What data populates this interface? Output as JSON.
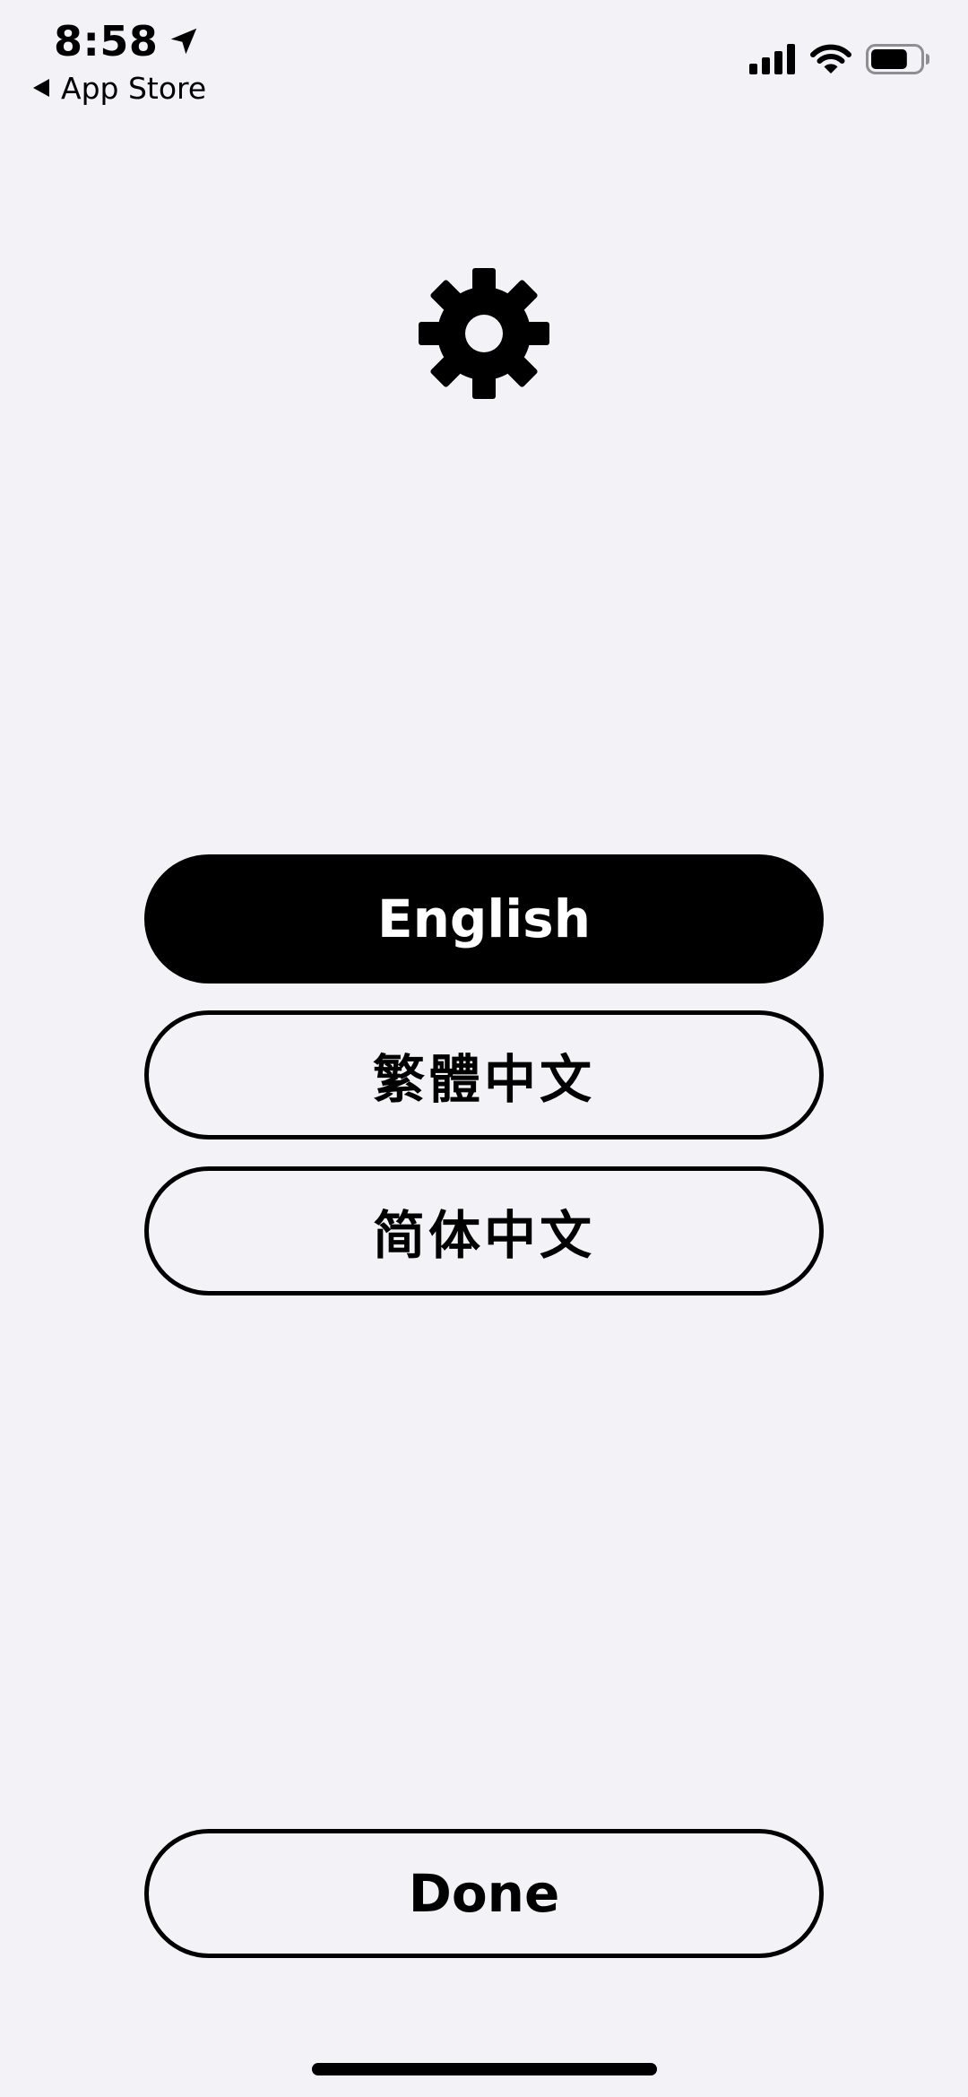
{
  "status_bar": {
    "time": "8:58",
    "back_app_label": "App Store",
    "location_icon": "location-arrow-icon",
    "signal_icon": "cellular-signal-icon",
    "wifi_icon": "wifi-icon",
    "battery_icon": "battery-icon",
    "battery_level": 0.75
  },
  "header": {
    "icon": "gear-icon"
  },
  "languages": [
    {
      "label": "English",
      "selected": true
    },
    {
      "label": "繁體中文",
      "selected": false
    },
    {
      "label": "简体中文",
      "selected": false
    }
  ],
  "footer": {
    "done_label": "Done"
  },
  "colors": {
    "background": "#f2f2f7",
    "accent": "#000000",
    "selected_text": "#ffffff"
  }
}
